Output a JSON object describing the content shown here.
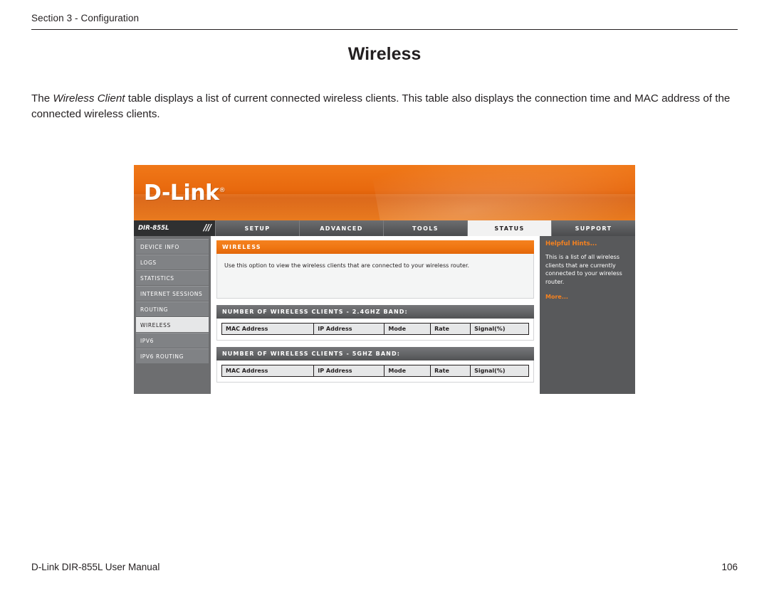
{
  "header": {
    "section_label": "Section 3 - Configuration"
  },
  "title": "Wireless",
  "paragraph": {
    "lead": "The ",
    "emphasis": "Wireless Client",
    "rest": " table displays a list of current connected wireless clients. This table also displays the connection time and MAC address of the connected wireless clients."
  },
  "router_ui": {
    "logo": "D-Link",
    "logo_mark": "®",
    "nav": {
      "model": "DIR-855L",
      "slashes": "///",
      "tabs": [
        {
          "label": "SETUP",
          "active": false
        },
        {
          "label": "ADVANCED",
          "active": false
        },
        {
          "label": "TOOLS",
          "active": false
        },
        {
          "label": "STATUS",
          "active": true
        },
        {
          "label": "SUPPORT",
          "active": false
        }
      ]
    },
    "sidebar": [
      {
        "label": "DEVICE INFO",
        "active": false
      },
      {
        "label": "LOGS",
        "active": false
      },
      {
        "label": "STATISTICS",
        "active": false
      },
      {
        "label": "INTERNET SESSIONS",
        "active": false
      },
      {
        "label": "ROUTING",
        "active": false
      },
      {
        "label": "WIRELESS",
        "active": true
      },
      {
        "label": "IPV6",
        "active": false
      },
      {
        "label": "IPV6 ROUTING",
        "active": false
      }
    ],
    "panel": {
      "heading": "WIRELESS",
      "description": "Use this option to view the wireless clients that are connected to your wireless router."
    },
    "sections": [
      {
        "heading": "NUMBER OF WIRELESS CLIENTS - 2.4GHZ BAND:",
        "columns": [
          "MAC Address",
          "IP Address",
          "Mode",
          "Rate",
          "Signal(%)"
        ]
      },
      {
        "heading": "NUMBER OF WIRELESS CLIENTS - 5GHZ BAND:",
        "columns": [
          "MAC Address",
          "IP Address",
          "Mode",
          "Rate",
          "Signal(%)"
        ]
      }
    ],
    "hints": {
      "title": "Helpful Hints...",
      "body": "This is a list of all wireless clients that are currently connected to your wireless router.",
      "more": "More..."
    }
  },
  "footer": {
    "left": "D-Link DIR-855L User Manual",
    "right": "106"
  }
}
